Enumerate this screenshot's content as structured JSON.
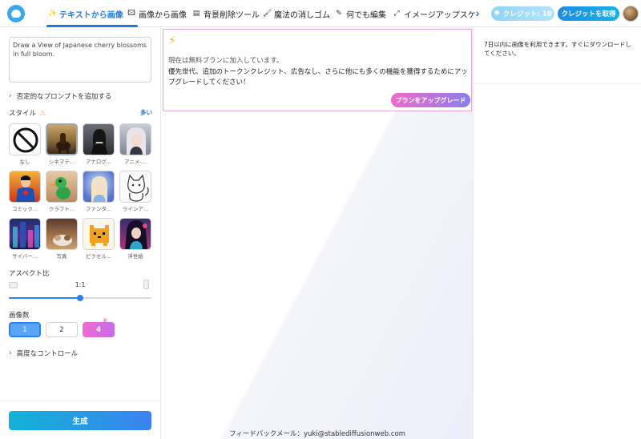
{
  "header": {
    "tabs": [
      {
        "label": "テキストから画像",
        "icon": "magic-wand-icon",
        "glyph": "✨",
        "active": true
      },
      {
        "label": "画像から画像",
        "icon": "image-icon",
        "glyph": "🖾",
        "active": false
      },
      {
        "label": "背景削除ツール",
        "icon": "layers-icon",
        "glyph": "▤",
        "active": false
      },
      {
        "label": "魔法の消しゴム",
        "icon": "eraser-icon",
        "glyph": "🖌",
        "active": false
      },
      {
        "label": "何でも編集",
        "icon": "pen-icon",
        "glyph": "✎",
        "active": false
      },
      {
        "label": "イメージアップスケ-",
        "icon": "expand-icon",
        "glyph": "⤢",
        "active": false
      }
    ],
    "credits_label": "クレジット: 10",
    "get_credits_label": "クレジットを取得"
  },
  "left": {
    "prompt_text": "Draw a View of Japanese cherry blossoms in full bloom.",
    "negative_prompt_label": "否定的なプロンプトを追加する",
    "style_label": "スタイル",
    "more_label": "多い",
    "styles": [
      {
        "caption": "なし",
        "icon": "none-icon",
        "selected": false
      },
      {
        "caption": "シネマテ...",
        "icon": "cinematic-thumbnail",
        "selected": true
      },
      {
        "caption": "アナログ...",
        "icon": "analog-thumbnail",
        "selected": false
      },
      {
        "caption": "アニメ-...",
        "icon": "anime-thumbnail",
        "selected": false
      },
      {
        "caption": "コミック...",
        "icon": "comic-thumbnail",
        "selected": false
      },
      {
        "caption": "クラフト...",
        "icon": "craft-thumbnail",
        "selected": false
      },
      {
        "caption": "ファンタ...",
        "icon": "fantasy-thumbnail",
        "selected": false
      },
      {
        "caption": "ラインア...",
        "icon": "lineart-thumbnail",
        "selected": false
      },
      {
        "caption": "サイバー...",
        "icon": "cyber-thumbnail",
        "selected": false
      },
      {
        "caption": "写真",
        "icon": "photo-thumbnail",
        "selected": false
      },
      {
        "caption": "ピクセル...",
        "icon": "pixel-thumbnail",
        "selected": false
      },
      {
        "caption": "浮世絵",
        "icon": "ukiyoe-thumbnail",
        "selected": false
      }
    ],
    "aspect_label": "アスペクト比",
    "aspect_value": "1:1",
    "aspect_slider_fraction": 0.5,
    "count_label": "画像数",
    "counts": [
      "1",
      "2",
      "4"
    ],
    "advanced_label": "高度なコントロール",
    "generate_label": "生成"
  },
  "center": {
    "upgrade_line1": "現在は無料プランに加入しています。",
    "upgrade_line2": "優先世代、追加のトークンクレジット、広告なし、さらに他にも多くの機能を獲得するためにアップグレードしてください！",
    "plan_button_label": "プランをアップグレード",
    "feedback_text": "フィードバックメール：yuki@stablediffusionweb.com"
  },
  "right": {
    "note": "7日以内に画像を利用できます。すぐにダウンロードしてください。"
  },
  "colors": {
    "accent": "#1f7ae0",
    "generate_gradient": [
      "#12b3d6",
      "#3b82f0"
    ],
    "upgrade_gradient": [
      "#f06bc7",
      "#8c7cf0"
    ]
  }
}
